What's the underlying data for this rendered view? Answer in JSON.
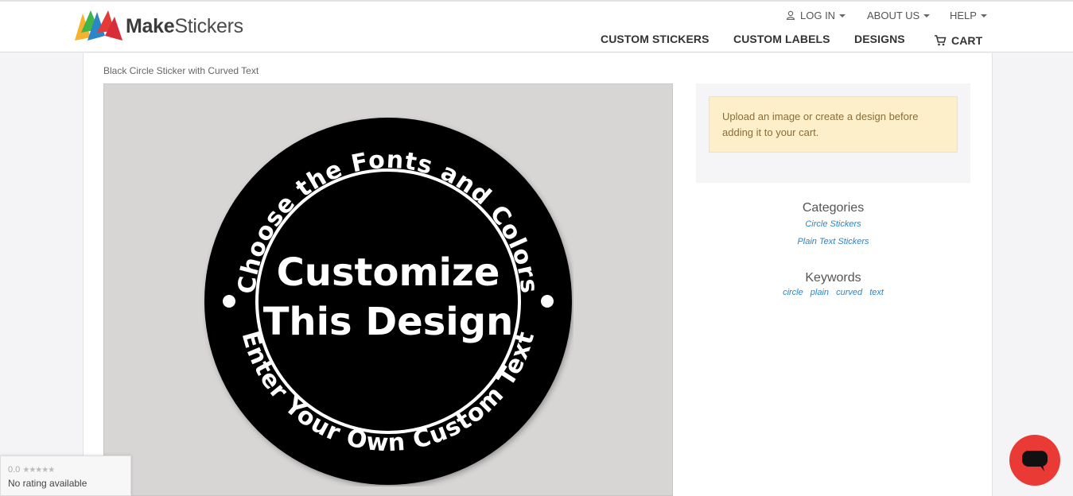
{
  "brand": {
    "name_bold": "Make",
    "name_rest": "Stickers"
  },
  "top_nav": {
    "login": "LOG IN",
    "about": "ABOUT US",
    "help": "HELP"
  },
  "main_nav": {
    "custom_stickers": "CUSTOM STICKERS",
    "custom_labels": "CUSTOM LABELS",
    "designs": "DESIGNS",
    "cart": "CART"
  },
  "breadcrumb": "Black Circle Sticker with Curved Text",
  "sticker": {
    "top_arc_text": "Choose the Fonts and Colors",
    "bottom_arc_text": "Enter Your Own Custom Text",
    "center_line1": "Customize",
    "center_line2": "This Design"
  },
  "alert": "Upload an image or create a design before adding it to your cart.",
  "categories": {
    "title": "Categories",
    "links": [
      "Circle Stickers",
      "Plain Text Stickers"
    ]
  },
  "keywords": {
    "title": "Keywords",
    "items": [
      "circle",
      "plain",
      "curved",
      "text"
    ]
  },
  "rating": {
    "score": "0.0",
    "stars": "★★★★★",
    "text": "No rating available"
  },
  "colors": {
    "accent_link": "#2a86c8",
    "chat_button": "#ea3a35",
    "alert_bg": "#fcefc9"
  }
}
